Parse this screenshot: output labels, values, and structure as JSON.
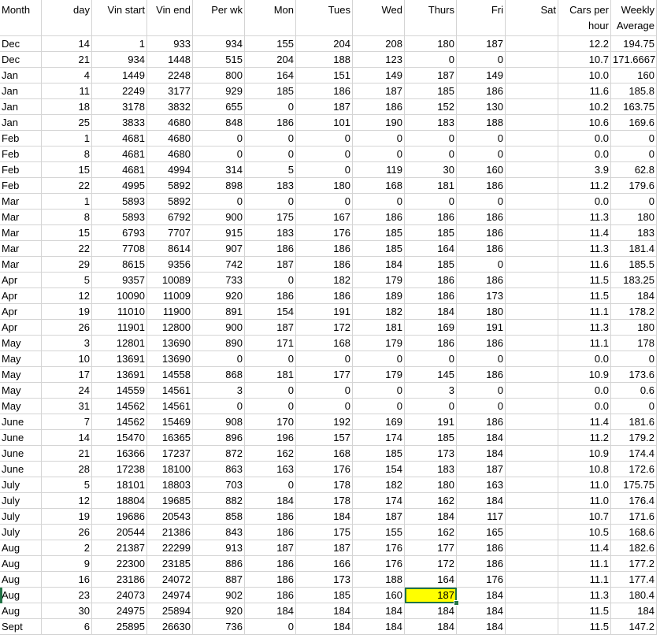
{
  "columns": [
    {
      "key": "month",
      "header": [
        "Month"
      ],
      "align": "left"
    },
    {
      "key": "day",
      "header": [
        "day"
      ],
      "align": "right"
    },
    {
      "key": "vin_start",
      "header": [
        "Vin start"
      ],
      "align": "right"
    },
    {
      "key": "vin_end",
      "header": [
        "Vin end"
      ],
      "align": "right"
    },
    {
      "key": "per_wk",
      "header": [
        "Per wk"
      ],
      "align": "right"
    },
    {
      "key": "mon",
      "header": [
        "Mon"
      ],
      "align": "right"
    },
    {
      "key": "tues",
      "header": [
        "Tues"
      ],
      "align": "right"
    },
    {
      "key": "wed",
      "header": [
        "Wed"
      ],
      "align": "right"
    },
    {
      "key": "thurs",
      "header": [
        "Thurs"
      ],
      "align": "right"
    },
    {
      "key": "fri",
      "header": [
        "Fri"
      ],
      "align": "right"
    },
    {
      "key": "sat",
      "header": [
        "Sat"
      ],
      "align": "right"
    },
    {
      "key": "cars_per_hour",
      "header": [
        "Cars per",
        "hour"
      ],
      "align": "right"
    },
    {
      "key": "weekly_average",
      "header": [
        "Weekly",
        "Average"
      ],
      "align": "right"
    }
  ],
  "rows": [
    [
      "Dec",
      "14",
      "1",
      "933",
      "934",
      "155",
      "204",
      "208",
      "180",
      "187",
      "",
      "12.2",
      "194.75"
    ],
    [
      "Dec",
      "21",
      "934",
      "1448",
      "515",
      "204",
      "188",
      "123",
      "0",
      "0",
      "",
      "10.7",
      "171.6667"
    ],
    [
      "Jan",
      "4",
      "1449",
      "2248",
      "800",
      "164",
      "151",
      "149",
      "187",
      "149",
      "",
      "10.0",
      "160"
    ],
    [
      "Jan",
      "11",
      "2249",
      "3177",
      "929",
      "185",
      "186",
      "187",
      "185",
      "186",
      "",
      "11.6",
      "185.8"
    ],
    [
      "Jan",
      "18",
      "3178",
      "3832",
      "655",
      "0",
      "187",
      "186",
      "152",
      "130",
      "",
      "10.2",
      "163.75"
    ],
    [
      "Jan",
      "25",
      "3833",
      "4680",
      "848",
      "186",
      "101",
      "190",
      "183",
      "188",
      "",
      "10.6",
      "169.6"
    ],
    [
      "Feb",
      "1",
      "4681",
      "4680",
      "0",
      "0",
      "0",
      "0",
      "0",
      "0",
      "",
      "0.0",
      "0"
    ],
    [
      "Feb",
      "8",
      "4681",
      "4680",
      "0",
      "0",
      "0",
      "0",
      "0",
      "0",
      "",
      "0.0",
      "0"
    ],
    [
      "Feb",
      "15",
      "4681",
      "4994",
      "314",
      "5",
      "0",
      "119",
      "30",
      "160",
      "",
      "3.9",
      "62.8"
    ],
    [
      "Feb",
      "22",
      "4995",
      "5892",
      "898",
      "183",
      "180",
      "168",
      "181",
      "186",
      "",
      "11.2",
      "179.6"
    ],
    [
      "Mar",
      "1",
      "5893",
      "5892",
      "0",
      "0",
      "0",
      "0",
      "0",
      "0",
      "",
      "0.0",
      "0"
    ],
    [
      "Mar",
      "8",
      "5893",
      "6792",
      "900",
      "175",
      "167",
      "186",
      "186",
      "186",
      "",
      "11.3",
      "180"
    ],
    [
      "Mar",
      "15",
      "6793",
      "7707",
      "915",
      "183",
      "176",
      "185",
      "185",
      "186",
      "",
      "11.4",
      "183"
    ],
    [
      "Mar",
      "22",
      "7708",
      "8614",
      "907",
      "186",
      "186",
      "185",
      "164",
      "186",
      "",
      "11.3",
      "181.4"
    ],
    [
      "Mar",
      "29",
      "8615",
      "9356",
      "742",
      "187",
      "186",
      "184",
      "185",
      "0",
      "",
      "11.6",
      "185.5"
    ],
    [
      "Apr",
      "5",
      "9357",
      "10089",
      "733",
      "0",
      "182",
      "179",
      "186",
      "186",
      "",
      "11.5",
      "183.25"
    ],
    [
      "Apr",
      "12",
      "10090",
      "11009",
      "920",
      "186",
      "186",
      "189",
      "186",
      "173",
      "",
      "11.5",
      "184"
    ],
    [
      "Apr",
      "19",
      "11010",
      "11900",
      "891",
      "154",
      "191",
      "182",
      "184",
      "180",
      "",
      "11.1",
      "178.2"
    ],
    [
      "Apr",
      "26",
      "11901",
      "12800",
      "900",
      "187",
      "172",
      "181",
      "169",
      "191",
      "",
      "11.3",
      "180"
    ],
    [
      "May",
      "3",
      "12801",
      "13690",
      "890",
      "171",
      "168",
      "179",
      "186",
      "186",
      "",
      "11.1",
      "178"
    ],
    [
      "May",
      "10",
      "13691",
      "13690",
      "0",
      "0",
      "0",
      "0",
      "0",
      "0",
      "",
      "0.0",
      "0"
    ],
    [
      "May",
      "17",
      "13691",
      "14558",
      "868",
      "181",
      "177",
      "179",
      "145",
      "186",
      "",
      "10.9",
      "173.6"
    ],
    [
      "May",
      "24",
      "14559",
      "14561",
      "3",
      "0",
      "0",
      "0",
      "3",
      "0",
      "",
      "0.0",
      "0.6"
    ],
    [
      "May",
      "31",
      "14562",
      "14561",
      "0",
      "0",
      "0",
      "0",
      "0",
      "0",
      "",
      "0.0",
      "0"
    ],
    [
      "June",
      "7",
      "14562",
      "15469",
      "908",
      "170",
      "192",
      "169",
      "191",
      "186",
      "",
      "11.4",
      "181.6"
    ],
    [
      "June",
      "14",
      "15470",
      "16365",
      "896",
      "196",
      "157",
      "174",
      "185",
      "184",
      "",
      "11.2",
      "179.2"
    ],
    [
      "June",
      "21",
      "16366",
      "17237",
      "872",
      "162",
      "168",
      "185",
      "173",
      "184",
      "",
      "10.9",
      "174.4"
    ],
    [
      "June",
      "28",
      "17238",
      "18100",
      "863",
      "163",
      "176",
      "154",
      "183",
      "187",
      "",
      "10.8",
      "172.6"
    ],
    [
      "July",
      "5",
      "18101",
      "18803",
      "703",
      "0",
      "178",
      "182",
      "180",
      "163",
      "",
      "11.0",
      "175.75"
    ],
    [
      "July",
      "12",
      "18804",
      "19685",
      "882",
      "184",
      "178",
      "174",
      "162",
      "184",
      "",
      "11.0",
      "176.4"
    ],
    [
      "July",
      "19",
      "19686",
      "20543",
      "858",
      "186",
      "184",
      "187",
      "184",
      "117",
      "",
      "10.7",
      "171.6"
    ],
    [
      "July",
      "26",
      "20544",
      "21386",
      "843",
      "186",
      "175",
      "155",
      "162",
      "165",
      "",
      "10.5",
      "168.6"
    ],
    [
      "Aug",
      "2",
      "21387",
      "22299",
      "913",
      "187",
      "187",
      "176",
      "177",
      "186",
      "",
      "11.4",
      "182.6"
    ],
    [
      "Aug",
      "9",
      "22300",
      "23185",
      "886",
      "186",
      "166",
      "176",
      "172",
      "186",
      "",
      "11.1",
      "177.2"
    ],
    [
      "Aug",
      "16",
      "23186",
      "24072",
      "887",
      "186",
      "173",
      "188",
      "164",
      "176",
      "",
      "11.1",
      "177.4"
    ],
    [
      "Aug",
      "23",
      "24073",
      "24974",
      "902",
      "186",
      "185",
      "160",
      "187",
      "184",
      "",
      "11.3",
      "180.4"
    ],
    [
      "Aug",
      "30",
      "24975",
      "25894",
      "920",
      "184",
      "184",
      "184",
      "184",
      "184",
      "",
      "11.5",
      "184"
    ],
    [
      "Sept",
      "6",
      "25895",
      "26630",
      "736",
      "0",
      "184",
      "184",
      "184",
      "184",
      "",
      "11.5",
      "147.2"
    ]
  ],
  "selected_cell": {
    "row": 35,
    "col": 8
  },
  "colors": {
    "selection_fill": "#ffff00",
    "selection_border": "#217346",
    "gridline": "#d4d4d4"
  }
}
